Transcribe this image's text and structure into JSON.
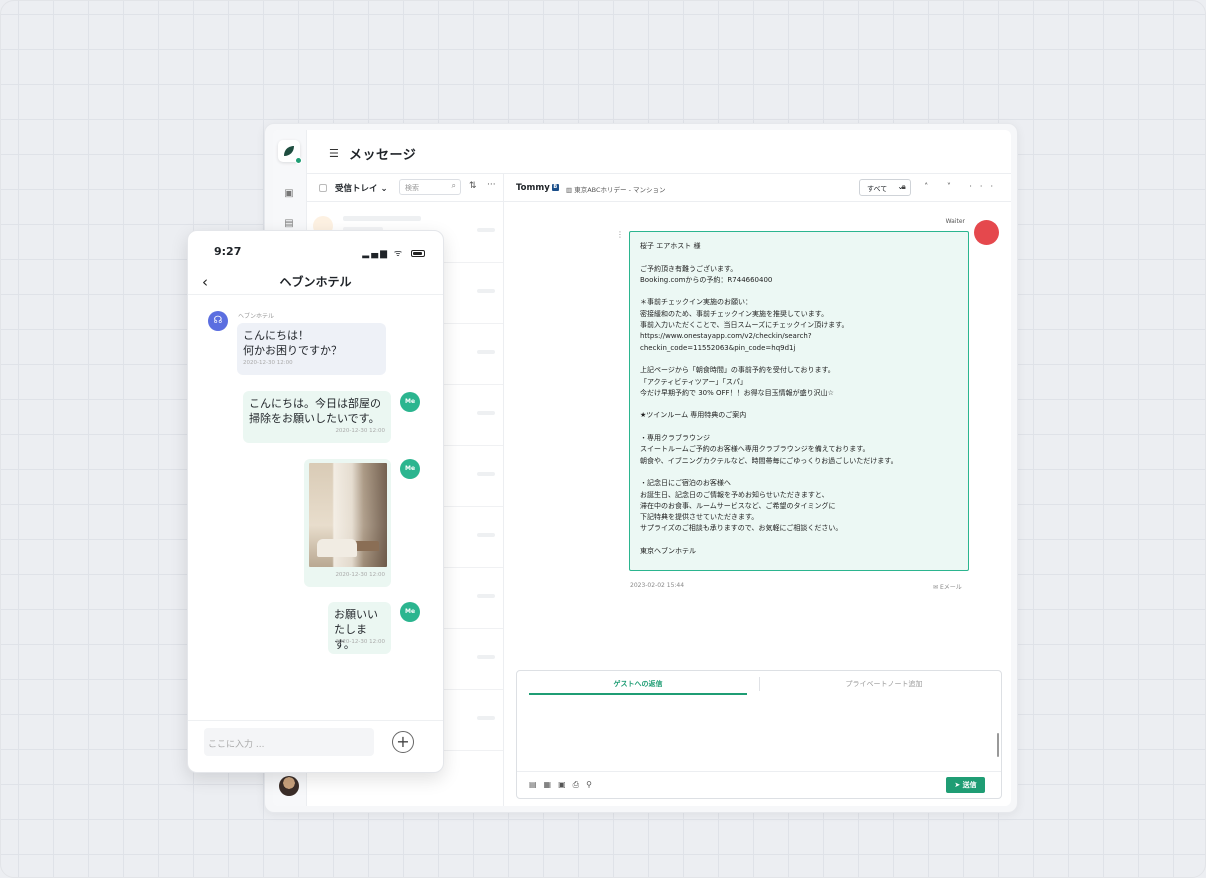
{
  "desktop": {
    "page_title": "メッセージ",
    "list": {
      "inbox_label": "受信トレイ",
      "search_placeholder": "検索",
      "row_count": 9
    },
    "detail": {
      "guest_name": "Tommy",
      "property": "東京ABCホリデー - マンション",
      "filter_value": "すべて",
      "sender_label": "Waiter",
      "email_body": "桜子 エアホスト 様\n\nご予約頂き有難うございます。\nBooking.comからの予約：R744660400\n\n＊事前チェックイン実施のお願い：\n密接緩和のため、事前チェックイン実施を推奨しています。\n事前入力いただくことで、当日スムーズにチェックイン頂けます。\nhttps://www.onestayapp.com/v2/checkin/search?\ncheckin_code=11552063&pin_code=hq9d1j\n\n上記ページから「朝食時間」の事前予約を受付しております。\n「アクティビティツアー」「スパ」\n今だけ早期予約で 30% OFF！！お得な目玉情報が盛り沢山☆\n\n★ツインルーム 専用特典のご案内\n\n・専用クラブラウンジ\nスイートルームご予約のお客様へ専用クラブラウンジを備えております。\n朝食や、イブニングカクテルなど、時間帯毎にごゆっくりお過ごしいただけます。\n\n・記念日にご宿泊のお客様へ\nお誕生日、記念日のご情報を予めお知らせいただきますと、\n滞在中のお食事、ルームサービスなど、ご希望のタイミングに\n下記特典を提供させていただきます。\nサプライズのご相談も承りますので、お気軽にご相談ください。\n\n東京ヘブンホテル",
      "email_date": "2023-02-02 15:44",
      "email_source": "Eメール"
    },
    "composer": {
      "tab_reply": "ゲストへの返信",
      "tab_note": "プライベートノート追加",
      "send_label": "送信"
    }
  },
  "phone": {
    "time": "9:27",
    "title": "ヘブンホテル",
    "bot_name": "ヘブンホテル",
    "messages": [
      {
        "text": "こんにちは！\n何かお困りですか？",
        "time": "2020-12-30 12:00",
        "from": "hotel"
      },
      {
        "text": "こんにちは。今日は部屋の掃除をお願いしたいです。",
        "time": "2020-12-30 12:00",
        "from": "me"
      },
      {
        "text": "",
        "time": "2020-12-30 12:00",
        "from": "me",
        "image": "room-photo"
      },
      {
        "text": "お願いいたします。",
        "time": "2020-12-30 12:00",
        "from": "me"
      }
    ],
    "me_label": "Me",
    "input_placeholder": "ここに入力 ..."
  },
  "colors": {
    "accent": "#1f9d74",
    "email_bg": "#ecf8f4",
    "avatar_red": "#e5484d",
    "bot_avatar": "#5b6ee0"
  }
}
